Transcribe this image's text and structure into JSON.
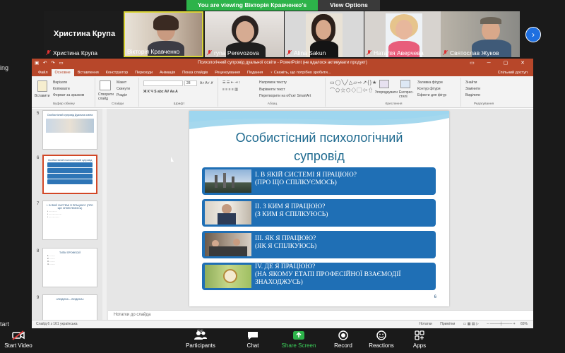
{
  "banner": {
    "text": "You are viewing Вікторія Кравченко's screen",
    "options_label": "View Options"
  },
  "left_edge": {
    "labels": [
      "ing",
      "tart"
    ]
  },
  "participants": [
    {
      "name": "Христина Крупа",
      "big_name": "Христина Крупа",
      "muted": true
    },
    {
      "name": "Вікторія Кравченко",
      "muted": false
    },
    {
      "name": "ryna Perevozova",
      "muted": true
    },
    {
      "name": "Alina Sakun",
      "muted": true
    },
    {
      "name": "Наталія Аверчева",
      "muted": true
    },
    {
      "name": "Святослав Жуков",
      "muted": true
    }
  ],
  "ppt": {
    "title": "Психологічний супровід дуальної освіти - PowerPoint (не вдалося активувати продукт)",
    "tabs": [
      "Файл",
      "Основне",
      "Вставлення",
      "Конструктор",
      "Переходи",
      "Анімація",
      "Показ слайдів",
      "Рецензування",
      "Подання",
      "♀ Скажіть, що потрібно зробити..."
    ],
    "share_label": "Спільний доступ",
    "ribbon": {
      "clipboard": {
        "paste": "Вставити",
        "cut": "Вирізати",
        "copy": "Копіювати",
        "format": "Формат за зразком",
        "label": "Буфер обміну"
      },
      "slides": {
        "new": "Створити слайд",
        "layout": "Макет",
        "reset": "Скинути",
        "section": "Розділ",
        "label": "Слайди"
      },
      "font": {
        "size": "28",
        "label": "Шрифт"
      },
      "paragraph": {
        "dir": "Напрямок тексту",
        "align": "Вирівняти текст",
        "smartart": "Перетворити на об'єкт SmartArt",
        "label": "Абзац"
      },
      "drawing": {
        "arrange": "Упорядкувати",
        "styles": "Експрес-стилі",
        "fill": "Заливка фігури",
        "outline": "Контур фігури",
        "effects": "Ефекти для фігур",
        "label": "Креслення"
      },
      "editing": {
        "find": "Знайти",
        "replace": "Замінити",
        "select": "Виділити",
        "label": "Редагування"
      }
    },
    "thumbnails": [
      {
        "num": "5",
        "title": "Особистісний супровід Дуальна освіта"
      },
      {
        "num": "6",
        "title": "Особистісний психологічний супровід"
      },
      {
        "num": "7",
        "title": "I. В ЯКІЙ СИСТЕМІ Я ПРАЦЮЮ? (ПРО ЩО СПІЛКУЄМОСЬ)"
      },
      {
        "num": "8",
        "title": "ТИПИ ПРОФЕСІЙ"
      },
      {
        "num": "9",
        "title": "«ЛЮДИНА – ЛЮДИНА»"
      }
    ],
    "slide": {
      "title_line1": "Особистісний психологічний",
      "title_line2": "супровід",
      "rows": [
        {
          "text": "I. В ЯКІЙ СИСТЕМІ Я ПРАЦЮЮ?\n(ПРО ЩО СПІЛКУЄМОСЬ)"
        },
        {
          "text": "II. З КИМ Я ПРАЦЮЮ?\n(З КИМ Я СПІЛКУЮСЬ)"
        },
        {
          "text": "III. ЯК Я ПРАЦЮЮ?\n(ЯК Я СПІЛКУЮСЬ)"
        },
        {
          "text": "IV. ДЕ Я ПРАЦЮЮ?\n(НА ЯКОМУ ЕТАПІ ПРОФЕСІЙНОЇ ВЗАЄМОДІЇ\nЗНАХОДЖУСЬ)"
        }
      ],
      "page_number": "6"
    },
    "notes_placeholder": "Нотатки до слайда",
    "status": {
      "left": "Слайд 6 з 161   українська",
      "notes": "Нотатки",
      "comments": "Примітки",
      "zoom": "65%"
    }
  },
  "toolbar": {
    "start_video": "Start Video",
    "participants": "Participants",
    "participants_count": "55",
    "chat": "Chat",
    "share": "Share Screen",
    "record": "Record",
    "reactions": "Reactions",
    "apps": "Apps"
  },
  "colors": {
    "share_green": "#2db34a",
    "ppt_red": "#b7472a",
    "slide_blue": "#1f6fb5",
    "zoom_blue": "#1e6fe0"
  }
}
